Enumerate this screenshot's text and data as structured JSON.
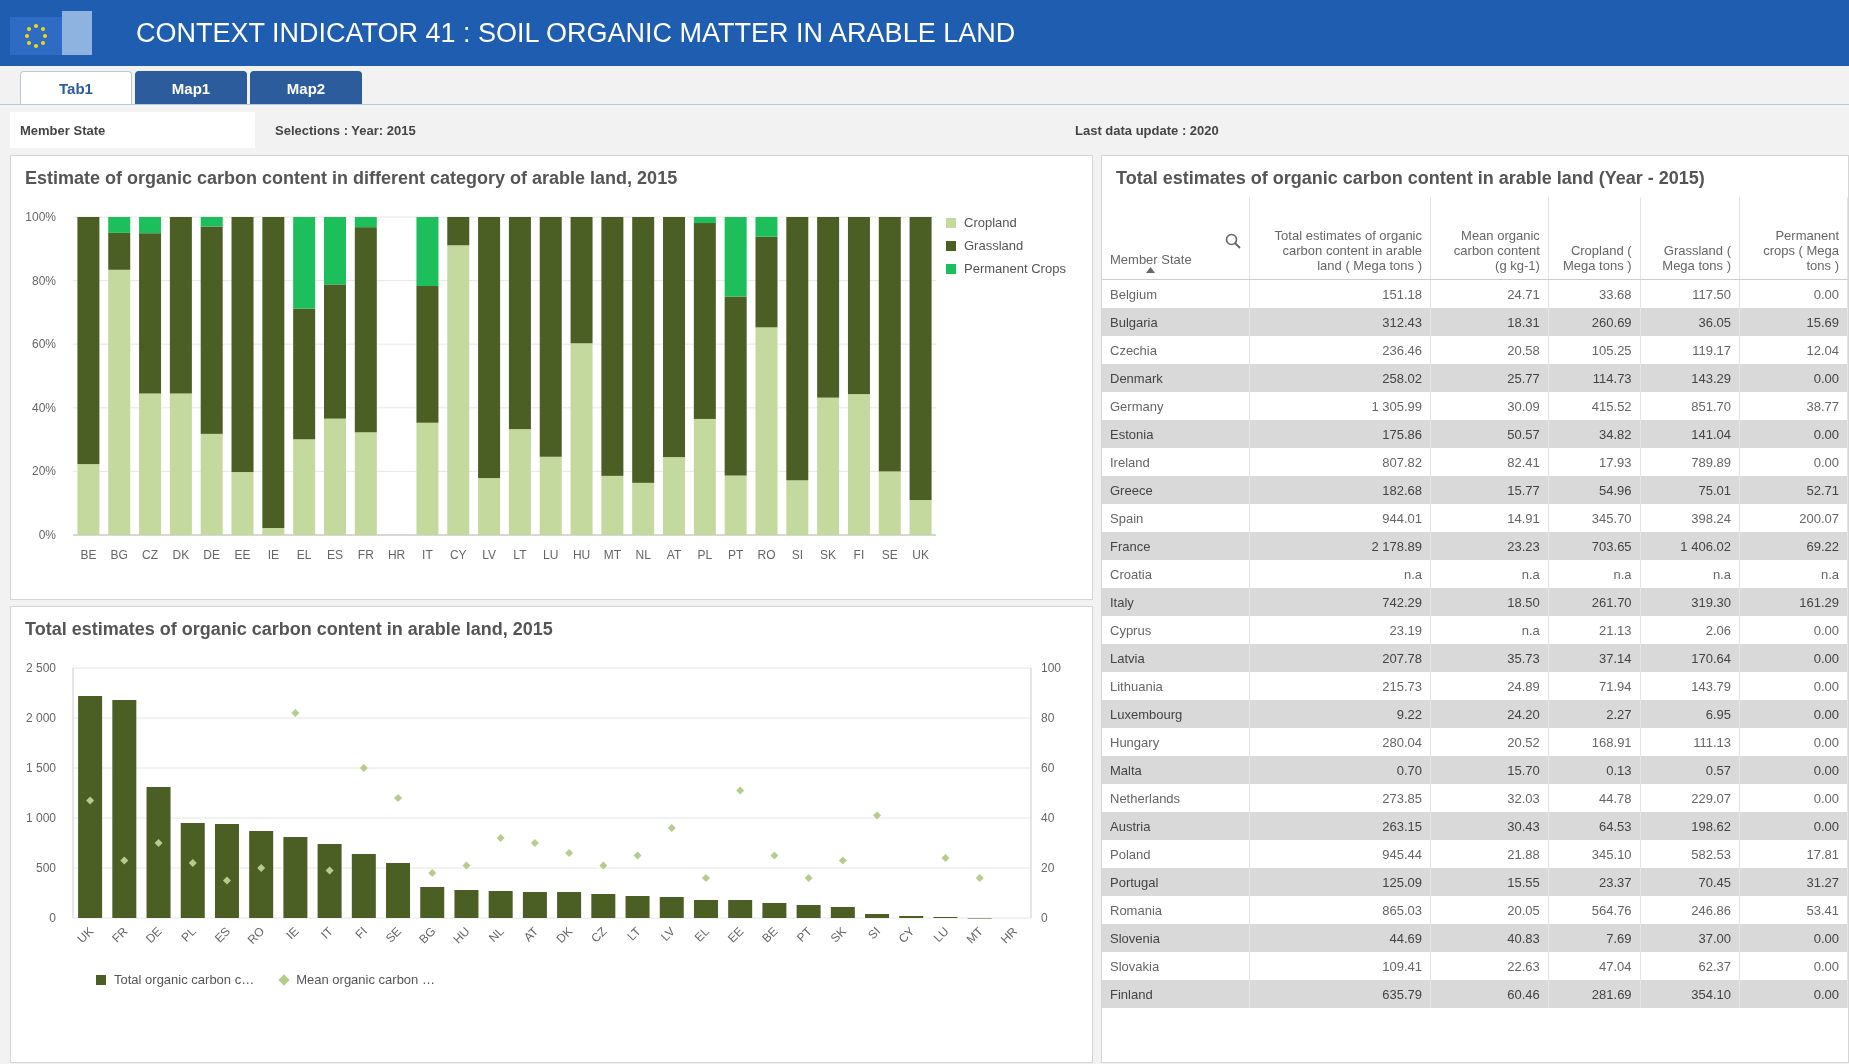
{
  "header": {
    "title": "CONTEXT INDICATOR 41 : SOIL ORGANIC MATTER IN ARABLE LAND"
  },
  "tabs": [
    {
      "label": "Tab1",
      "selected": true
    },
    {
      "label": "Map1",
      "selected": false
    },
    {
      "label": "Map2",
      "selected": false
    }
  ],
  "filter_bar": {
    "field_label": "Member State",
    "selections": "Selections : Year: 2015",
    "last_update": "Last data update : 2020"
  },
  "category_chart": {
    "title": "Estimate of organic carbon content in different category of arable land, 2015",
    "chart_data": {
      "type": "bar",
      "stacked": true,
      "grid": true,
      "ylim": [
        0,
        100
      ],
      "yticks": [
        {
          "value": 0,
          "label": "0%"
        },
        {
          "value": 20,
          "label": "20%"
        },
        {
          "value": 40,
          "label": "40%"
        },
        {
          "value": 60,
          "label": "60%"
        },
        {
          "value": 80,
          "label": "80%"
        },
        {
          "value": 100,
          "label": "100%"
        }
      ],
      "categories": [
        "BE",
        "BG",
        "CZ",
        "DK",
        "DE",
        "EE",
        "IE",
        "EL",
        "ES",
        "FR",
        "HR",
        "IT",
        "CY",
        "LV",
        "LT",
        "LU",
        "HU",
        "MT",
        "NL",
        "AT",
        "PL",
        "PT",
        "RO",
        "SI",
        "SK",
        "FI",
        "SE",
        "UK"
      ],
      "series": [
        {
          "name": "Cropland",
          "color": "#c4d99e",
          "values": [
            22.3,
            83.4,
            44.5,
            44.5,
            31.8,
            19.8,
            2.2,
            30.1,
            36.6,
            32.3,
            null,
            35.3,
            91.1,
            17.9,
            33.3,
            24.6,
            60.3,
            18.6,
            16.4,
            24.5,
            36.5,
            18.7,
            65.3,
            17.2,
            43.2,
            44.3,
            20.0,
            11.0
          ]
        },
        {
          "name": "Grassland",
          "color": "#4b5e24",
          "values": [
            77.7,
            11.6,
            50.4,
            55.5,
            65.2,
            80.2,
            97.8,
            41.1,
            42.2,
            64.5,
            null,
            43.0,
            8.9,
            82.1,
            66.7,
            75.4,
            39.7,
            81.4,
            83.6,
            75.5,
            61.6,
            56.3,
            28.5,
            82.8,
            56.8,
            55.7,
            80.0,
            89.0
          ]
        },
        {
          "name": "Permanent Crops",
          "color": "#1dbf5c",
          "values": [
            0,
            5.0,
            5.1,
            0,
            3.0,
            0,
            0,
            28.8,
            21.2,
            3.2,
            null,
            21.7,
            0,
            0,
            0,
            0,
            0,
            0,
            0,
            0,
            1.9,
            25.0,
            6.2,
            0,
            0,
            0,
            0,
            0
          ]
        }
      ]
    }
  },
  "totals_chart": {
    "title": "Total estimates of organic carbon content in arable land, 2015",
    "chart_data": {
      "type": "bar",
      "stacked": false,
      "grid": true,
      "ylim": [
        0,
        2500
      ],
      "yticks": [
        {
          "value": 0,
          "label": "0"
        },
        {
          "value": 500,
          "label": "500"
        },
        {
          "value": 1000,
          "label": "1 000"
        },
        {
          "value": 1500,
          "label": "1 500"
        },
        {
          "value": 2000,
          "label": "2 000"
        },
        {
          "value": 2500,
          "label": "2 500"
        }
      ],
      "y2lim": [
        0,
        100
      ],
      "y2ticks": [
        {
          "value": 0,
          "label": "0"
        },
        {
          "value": 20,
          "label": "20"
        },
        {
          "value": 40,
          "label": "40"
        },
        {
          "value": 60,
          "label": "60"
        },
        {
          "value": 80,
          "label": "80"
        },
        {
          "value": 100,
          "label": "100"
        }
      ],
      "categories": [
        "UK",
        "FR",
        "DE",
        "PL",
        "ES",
        "RO",
        "IE",
        "IT",
        "FI",
        "SE",
        "BG",
        "HU",
        "NL",
        "AT",
        "DK",
        "CZ",
        "LT",
        "LV",
        "EL",
        "EE",
        "BE",
        "PT",
        "SK",
        "SI",
        "CY",
        "LU",
        "MT",
        "HR"
      ],
      "series": [
        {
          "name": "Total organic carbon c…",
          "color": "#4b5e24",
          "values": [
            2220,
            2180,
            1310,
            950,
            940,
            870,
            810,
            740,
            640,
            550,
            310,
            280,
            270,
            260,
            260,
            240,
            220,
            210,
            180,
            180,
            150,
            130,
            110,
            40,
            20,
            10,
            0,
            null
          ]
        },
        {
          "name": "Mean organic carbon …",
          "color": "#b5cc8e",
          "type": "scatter",
          "axis": "y2",
          "values": [
            47,
            23,
            30,
            22,
            15,
            20,
            82,
            19,
            60,
            48,
            18,
            21,
            32,
            30,
            26,
            21,
            25,
            36,
            16,
            51,
            25,
            16,
            23,
            41,
            null,
            24,
            16,
            null
          ]
        }
      ]
    }
  },
  "table": {
    "title": "Total estimates of organic carbon content in arable land (Year - 2015)",
    "columns": [
      "Member State",
      "Total estimates of organic carbon content in arable land ( Mega tons )",
      "Mean organic carbon content (g kg-1)",
      "Cropland ( Mega tons )",
      "Grassland ( Mega tons )",
      "Permanent crops ( Mega tons )"
    ],
    "rows": [
      [
        "Belgium",
        "151.18",
        "24.71",
        "33.68",
        "117.50",
        "0.00"
      ],
      [
        "Bulgaria",
        "312.43",
        "18.31",
        "260.69",
        "36.05",
        "15.69"
      ],
      [
        "Czechia",
        "236.46",
        "20.58",
        "105.25",
        "119.17",
        "12.04"
      ],
      [
        "Denmark",
        "258.02",
        "25.77",
        "114.73",
        "143.29",
        "0.00"
      ],
      [
        "Germany",
        "1 305.99",
        "30.09",
        "415.52",
        "851.70",
        "38.77"
      ],
      [
        "Estonia",
        "175.86",
        "50.57",
        "34.82",
        "141.04",
        "0.00"
      ],
      [
        "Ireland",
        "807.82",
        "82.41",
        "17.93",
        "789.89",
        "0.00"
      ],
      [
        "Greece",
        "182.68",
        "15.77",
        "54.96",
        "75.01",
        "52.71"
      ],
      [
        "Spain",
        "944.01",
        "14.91",
        "345.70",
        "398.24",
        "200.07"
      ],
      [
        "France",
        "2 178.89",
        "23.23",
        "703.65",
        "1 406.02",
        "69.22"
      ],
      [
        "Croatia",
        "n.a",
        "n.a",
        "n.a",
        "n.a",
        "n.a"
      ],
      [
        "Italy",
        "742.29",
        "18.50",
        "261.70",
        "319.30",
        "161.29"
      ],
      [
        "Cyprus",
        "23.19",
        "n.a",
        "21.13",
        "2.06",
        "0.00"
      ],
      [
        "Latvia",
        "207.78",
        "35.73",
        "37.14",
        "170.64",
        "0.00"
      ],
      [
        "Lithuania",
        "215.73",
        "24.89",
        "71.94",
        "143.79",
        "0.00"
      ],
      [
        "Luxembourg",
        "9.22",
        "24.20",
        "2.27",
        "6.95",
        "0.00"
      ],
      [
        "Hungary",
        "280.04",
        "20.52",
        "168.91",
        "111.13",
        "0.00"
      ],
      [
        "Malta",
        "0.70",
        "15.70",
        "0.13",
        "0.57",
        "0.00"
      ],
      [
        "Netherlands",
        "273.85",
        "32.03",
        "44.78",
        "229.07",
        "0.00"
      ],
      [
        "Austria",
        "263.15",
        "30.43",
        "64.53",
        "198.62",
        "0.00"
      ],
      [
        "Poland",
        "945.44",
        "21.88",
        "345.10",
        "582.53",
        "17.81"
      ],
      [
        "Portugal",
        "125.09",
        "15.55",
        "23.37",
        "70.45",
        "31.27"
      ],
      [
        "Romania",
        "865.03",
        "20.05",
        "564.76",
        "246.86",
        "53.41"
      ],
      [
        "Slovenia",
        "44.69",
        "40.83",
        "7.69",
        "37.00",
        "0.00"
      ],
      [
        "Slovakia",
        "109.41",
        "22.63",
        "47.04",
        "62.37",
        "0.00"
      ],
      [
        "Finland",
        "635.79",
        "60.46",
        "281.69",
        "354.10",
        "0.00"
      ]
    ]
  }
}
